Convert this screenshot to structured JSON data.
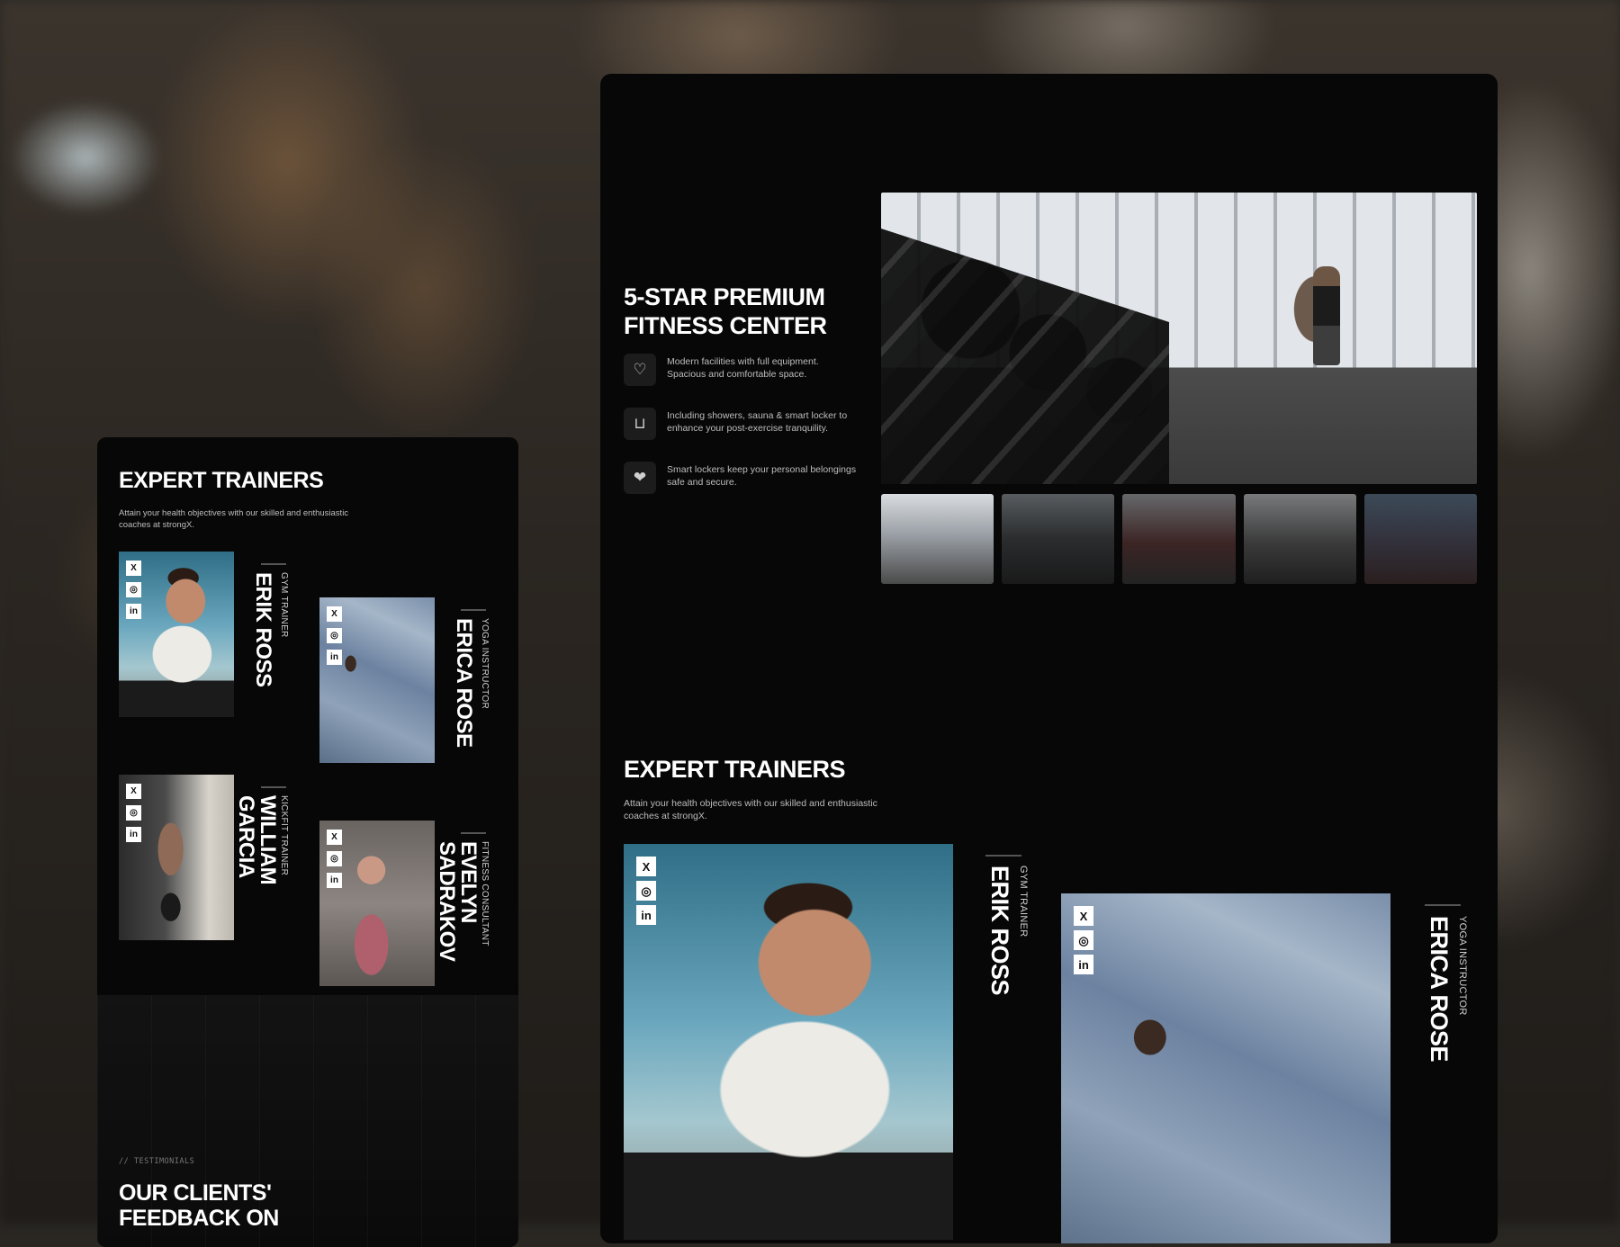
{
  "left_card": {
    "title": "EXPERT TRAINERS",
    "subtitle": "Attain your health objectives with our skilled and enthusiastic coaches at strongX.",
    "trainers": [
      {
        "name": "ERIK ROSS",
        "role": "GYM TRAINER"
      },
      {
        "name": "ERICA ROSE",
        "role": "YOGA INSTRUCTOR"
      },
      {
        "name": "WILLIAM GARCIA",
        "role": "KICKFIT TRAINER"
      },
      {
        "name": "EVELYN SADRAKOV",
        "role": "FITNESS CONSULTANT"
      }
    ],
    "testimonials_tag": "// TESTIMONIALS",
    "testimonials_title": "OUR CLIENTS' FEEDBACK ON"
  },
  "main_card": {
    "title": "5-STAR PREMIUM FITNESS CENTER",
    "features": [
      {
        "icon": "heart-pulse-icon",
        "text": "Modern facilities with full equipment. Spacious and comfortable space."
      },
      {
        "icon": "bathtub-icon",
        "text": "Including showers, sauna & smart locker to enhance your post-exercise tranquility."
      },
      {
        "icon": "heart-hand-icon",
        "text": "Smart lockers keep your personal belongings safe and secure."
      }
    ],
    "trainers_title": "EXPERT TRAINERS",
    "trainers_subtitle": "Attain your health objectives with our skilled and enthusiastic coaches at strongX.",
    "trainers": [
      {
        "name": "ERIK ROSS",
        "role": "GYM TRAINER"
      },
      {
        "name": "ERICA ROSE",
        "role": "YOGA INSTRUCTOR"
      }
    ]
  },
  "social_glyphs": {
    "x": "X",
    "instagram": "◎",
    "linkedin": "in"
  }
}
